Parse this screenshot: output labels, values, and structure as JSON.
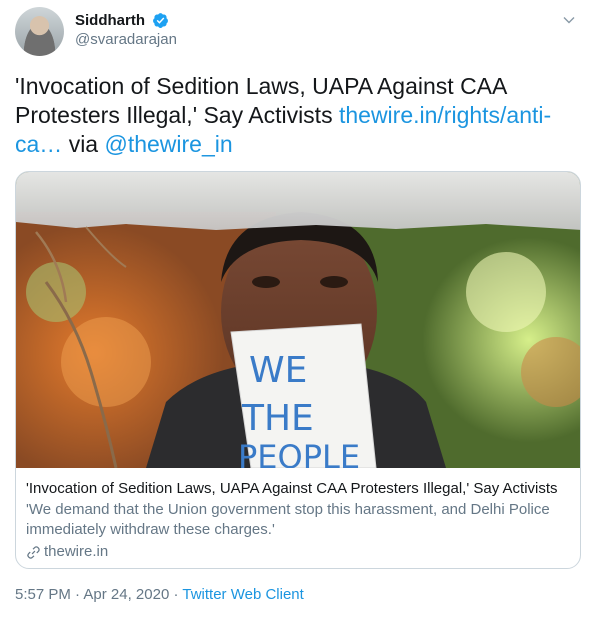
{
  "author": {
    "display_name": "Siddharth",
    "handle": "@svaradarajan",
    "verified": true
  },
  "tweet": {
    "text": "'Invocation of Sedition Laws, UAPA Against CAA Protesters Illegal,' Say Activists",
    "link": "thewire.in/rights/anti-ca…",
    "via_prefix": "via",
    "mention": "@thewire_in"
  },
  "card": {
    "image_text": [
      "WE",
      "THE",
      "PEOPLE"
    ],
    "title": "'Invocation of Sedition Laws, UAPA Against CAA Protesters Illegal,' Say Activists",
    "description": "'We demand that the Union government stop this harassment, and Delhi Police immediately withdraw these charges.'",
    "domain": "thewire.in"
  },
  "footer": {
    "time": "5:57 PM",
    "separator": "·",
    "date": "Apr 24, 2020",
    "source": "Twitter Web Client"
  },
  "colors": {
    "link": "#1b95e0",
    "secondary_text": "#657786",
    "border": "#ccd6dd",
    "verified": "#1da1f2"
  }
}
